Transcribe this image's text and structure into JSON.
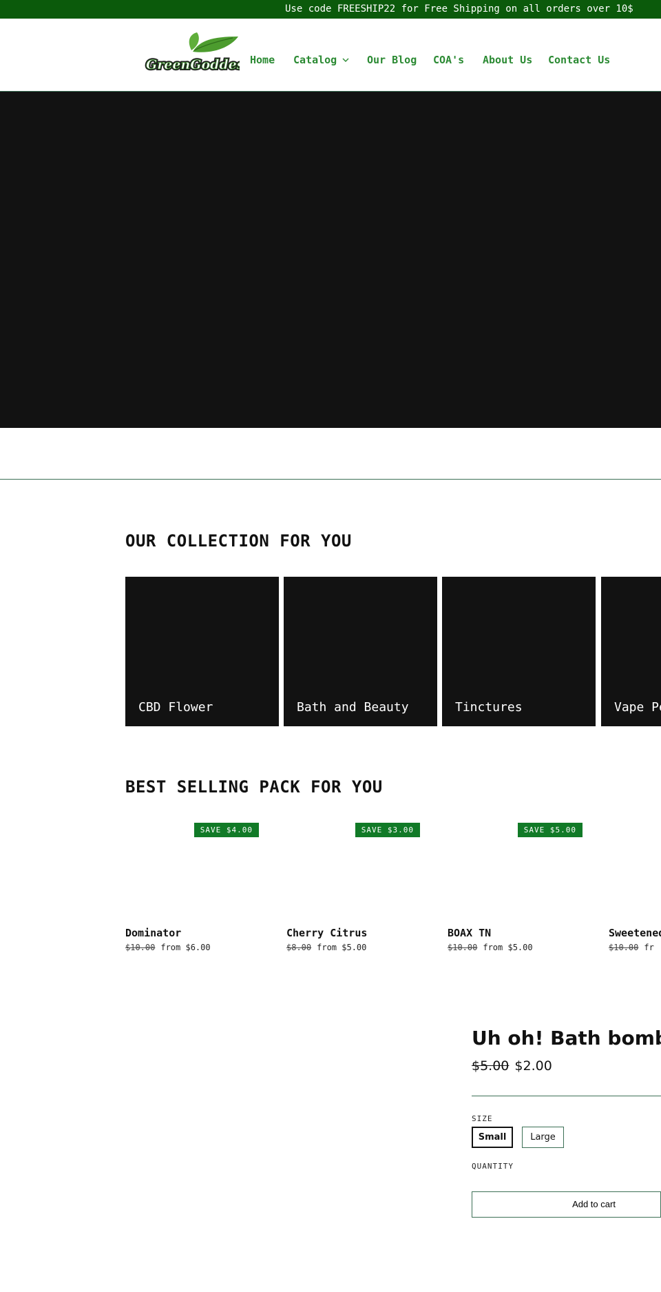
{
  "announcement": {
    "text": "Use code FREESHIP22 for Free Shipping on all orders over 10$"
  },
  "header": {
    "logo_text": "GreenGoddess",
    "nav": [
      {
        "label": "Home"
      },
      {
        "label": "Catalog",
        "icon": "chevron-down-icon"
      },
      {
        "label": "Our Blog"
      },
      {
        "label": "COA's"
      },
      {
        "label": "About Us"
      },
      {
        "label": "Contact Us"
      }
    ]
  },
  "collections": {
    "title": "OUR COLLECTION FOR YOU",
    "items": [
      {
        "label": "CBD Flower"
      },
      {
        "label": "Bath and Beauty"
      },
      {
        "label": "Tinctures"
      },
      {
        "label": "Vape Pe"
      }
    ]
  },
  "best_selling": {
    "title": "BEST SELLING PACK FOR YOU",
    "products": [
      {
        "name": "Dominator",
        "old_price": "$10.00",
        "price": "from $6.00",
        "badge": "SAVE $4.00"
      },
      {
        "name": "Cherry Citrus",
        "old_price": "$8.00",
        "price": "from $5.00",
        "badge": "SAVE $3.00"
      },
      {
        "name": "BOAX TN",
        "old_price": "$10.00",
        "price": "from $5.00",
        "badge": "SAVE $5.00"
      },
      {
        "name": "Sweetened",
        "old_price": "$10.00",
        "price": "fr",
        "badge": ""
      }
    ]
  },
  "featured": {
    "title": "Uh oh! Bath bombs",
    "old_price": "$5.00",
    "price": "$2.00",
    "size_label": "SIZE",
    "sizes": [
      "Small",
      "Large"
    ],
    "selected_size": "Small",
    "quantity_label": "QUANTITY",
    "add_to_cart": "Add to cart"
  },
  "colors": {
    "announcement_bg": "#0b5a0b",
    "nav_text": "#2b8a33",
    "badge_bg": "#117a27",
    "hero_bg": "#121212",
    "divider": "#3c6f55"
  }
}
